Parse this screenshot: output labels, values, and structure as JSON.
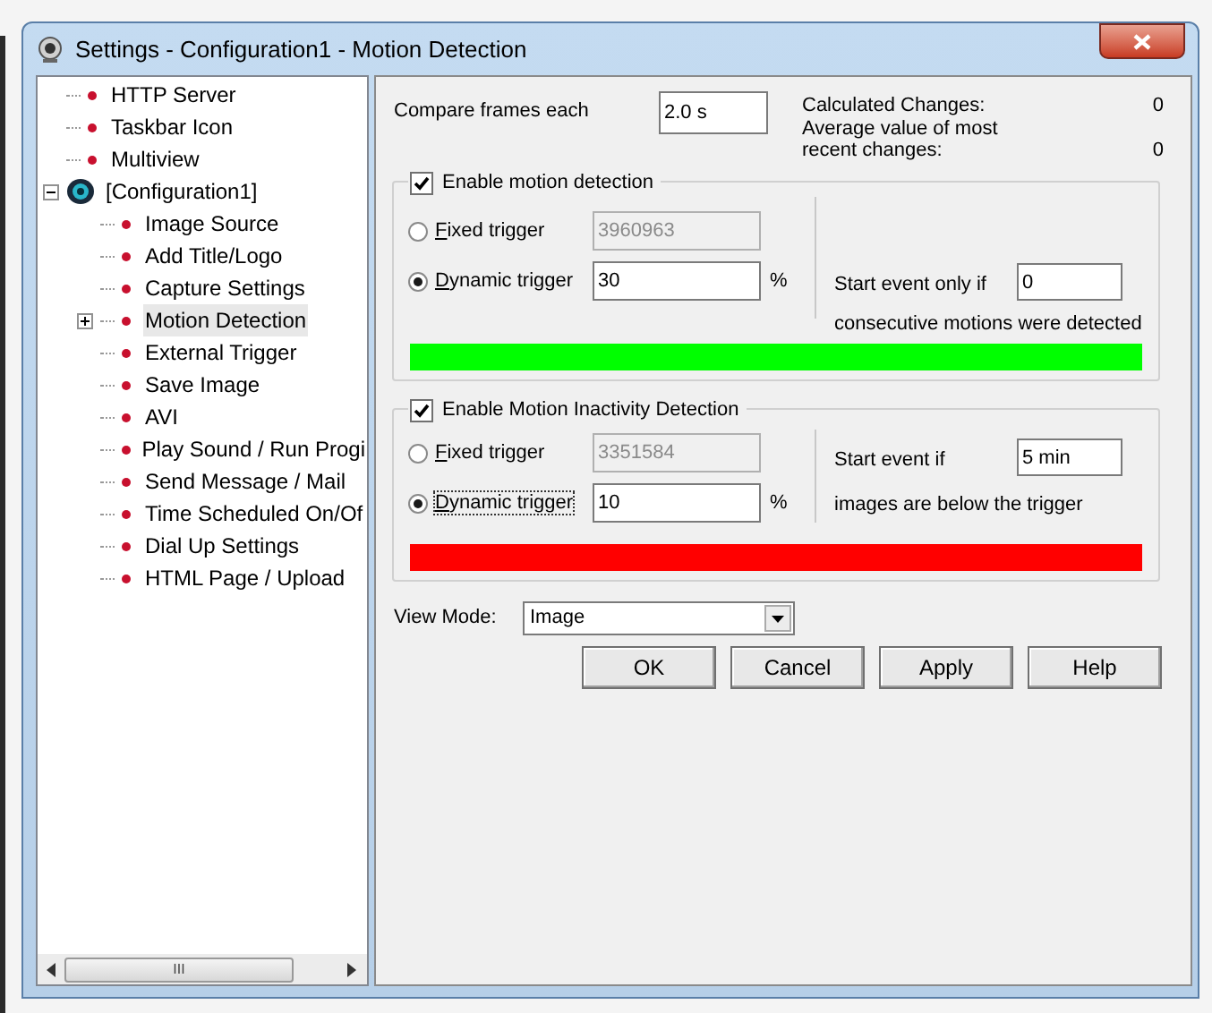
{
  "window": {
    "title": "Settings - Configuration1 - Motion Detection"
  },
  "tree": [
    {
      "label": "HTTP Server",
      "selected": false
    },
    {
      "label": "Taskbar Icon",
      "selected": false
    },
    {
      "label": "Multiview",
      "selected": false
    },
    {
      "label": "[Configuration1]",
      "selected": false,
      "expanded": true,
      "kind": "config",
      "children": [
        {
          "label": "Image Source",
          "selected": false
        },
        {
          "label": "Add Title/Logo",
          "selected": false
        },
        {
          "label": "Capture Settings",
          "selected": false
        },
        {
          "label": "Motion Detection",
          "selected": true,
          "expanded": false
        },
        {
          "label": "External Trigger",
          "selected": false
        },
        {
          "label": "Save Image",
          "selected": false
        },
        {
          "label": "AVI",
          "selected": false
        },
        {
          "label": "Play Sound / Run Progi",
          "selected": false
        },
        {
          "label": "Send Message / Mail",
          "selected": false
        },
        {
          "label": "Time Scheduled On/Of",
          "selected": false
        },
        {
          "label": "Dial Up Settings",
          "selected": false
        },
        {
          "label": "HTML Page / Upload",
          "selected": false
        }
      ]
    }
  ],
  "scrollbar_thumb": "III",
  "compare": {
    "label": "Compare frames each",
    "value": "2.0 s"
  },
  "stats": [
    {
      "label": "Calculated Changes:",
      "value": "0"
    },
    {
      "label": "Average value of most recent changes:",
      "value": "0"
    }
  ],
  "groups": [
    {
      "label": "Enable motion detection",
      "checked": true,
      "color": "#00ff00",
      "options": [
        {
          "label": "Fixed trigger",
          "selected": false,
          "value": "3960963",
          "disabled": true
        },
        {
          "label": "Dynamic trigger",
          "selected": true,
          "value": "30",
          "unit": "%",
          "disabled": false
        }
      ],
      "event": {
        "before": "Start event only if",
        "value": "0",
        "after": "consecutive motions were detected"
      }
    },
    {
      "label": "Enable Motion Inactivity Detection",
      "checked": true,
      "color": "#ff0000",
      "options": [
        {
          "label": "Fixed trigger",
          "selected": false,
          "value": "3351584",
          "disabled": true
        },
        {
          "label": "Dynamic trigger",
          "selected": true,
          "value": "10",
          "unit": "%",
          "disabled": false,
          "focused": true
        }
      ],
      "event": {
        "before": "Start event if",
        "value": "5 min",
        "after": "images are below the trigger"
      }
    }
  ],
  "view_mode": {
    "label": "View Mode:",
    "value": "Image"
  },
  "buttons": [
    "OK",
    "Cancel",
    "Apply",
    "Help"
  ]
}
